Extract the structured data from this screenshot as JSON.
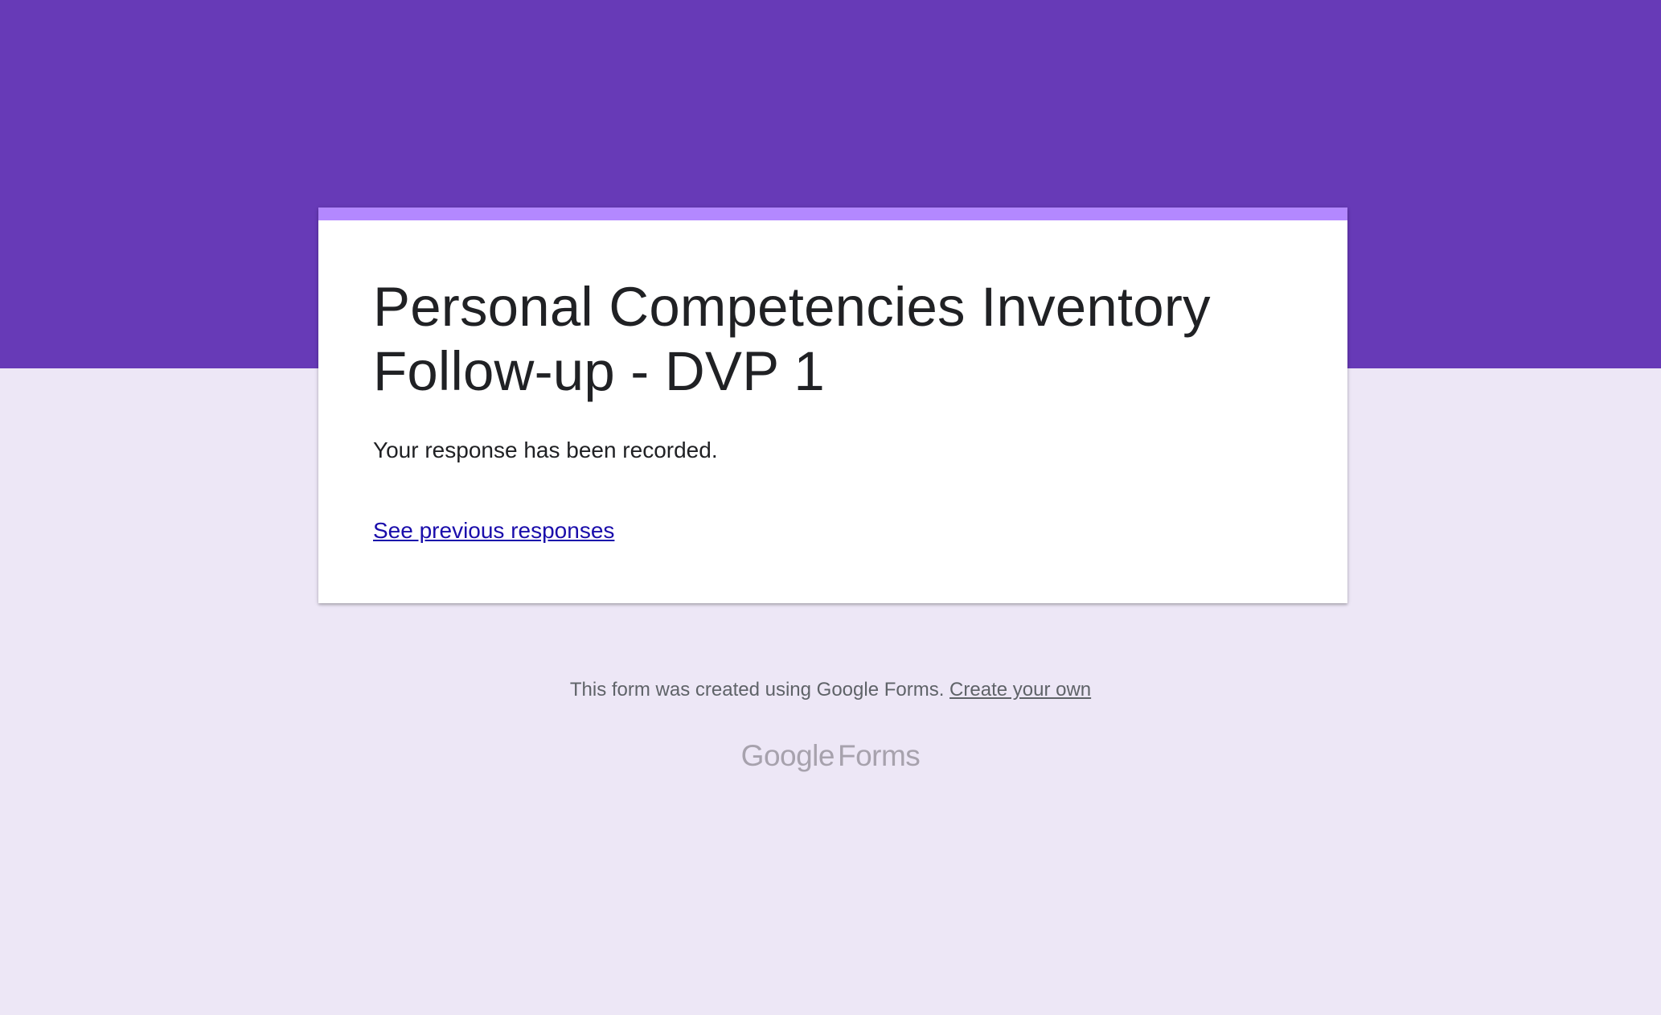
{
  "form": {
    "title_line1": "Personal Competencies Inventory",
    "title_line2": "Follow-up - DVP 1",
    "confirmation_message": "Your response has been recorded.",
    "previous_responses_link": "See previous responses"
  },
  "footer": {
    "created_text": "This form was created using Google Forms.",
    "create_own_link": "Create your own",
    "logo_google": "Google",
    "logo_forms": "Forms"
  },
  "colors": {
    "header_band": "#673ab7",
    "card_accent": "#b388ff",
    "page_background": "#ede7f6",
    "link": "#1a0dab"
  }
}
